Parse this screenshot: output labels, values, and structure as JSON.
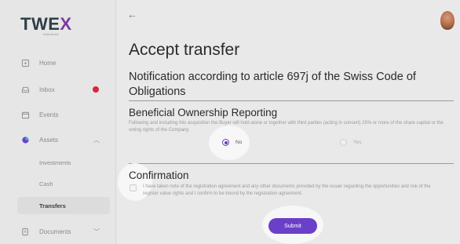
{
  "app": {
    "logo_main": "TWE",
    "logo_accent": "X",
    "logo_sub": "tokenized"
  },
  "sidebar": {
    "items": [
      {
        "label": "Home",
        "icon": "home-icon"
      },
      {
        "label": "Inbox",
        "icon": "inbox-icon",
        "badge_color": "#d8263b"
      },
      {
        "label": "Events",
        "icon": "calendar-icon"
      },
      {
        "label": "Assets",
        "icon": "pie-chart-icon",
        "expanded": true
      },
      {
        "label": "Documents",
        "icon": "documents-icon",
        "expanded": false
      }
    ],
    "assets_sub": [
      {
        "label": "Investments"
      },
      {
        "label": "Cash"
      },
      {
        "label": "Transfers",
        "active": true
      }
    ]
  },
  "header": {
    "back_glyph": "←"
  },
  "main": {
    "title": "Accept transfer",
    "subtitle": "Notification according to article 697j of the Swiss Code of Obligations",
    "beneficial": {
      "heading": "Beneficial Ownership Reporting",
      "text": "Following and including this acquisition the Buyer will hold alone or together with third parties (acting in concert) 25% or more of the share capital or the voting rights of the Company.",
      "options": [
        {
          "label": "No",
          "selected": true
        },
        {
          "label": "Yes",
          "selected": false
        }
      ]
    },
    "confirmation": {
      "heading": "Confirmation",
      "text": "I have taken note of the registration agreement and any other documents provided by the issuer regarding the opportunities and risk of the register value rights and I confirm to be bound by the registration agreement.",
      "checked": false
    },
    "submit_label": "Submit"
  },
  "colors": {
    "accent": "#6a40c8",
    "badge": "#d8263b",
    "background": "#e9e9e9"
  }
}
